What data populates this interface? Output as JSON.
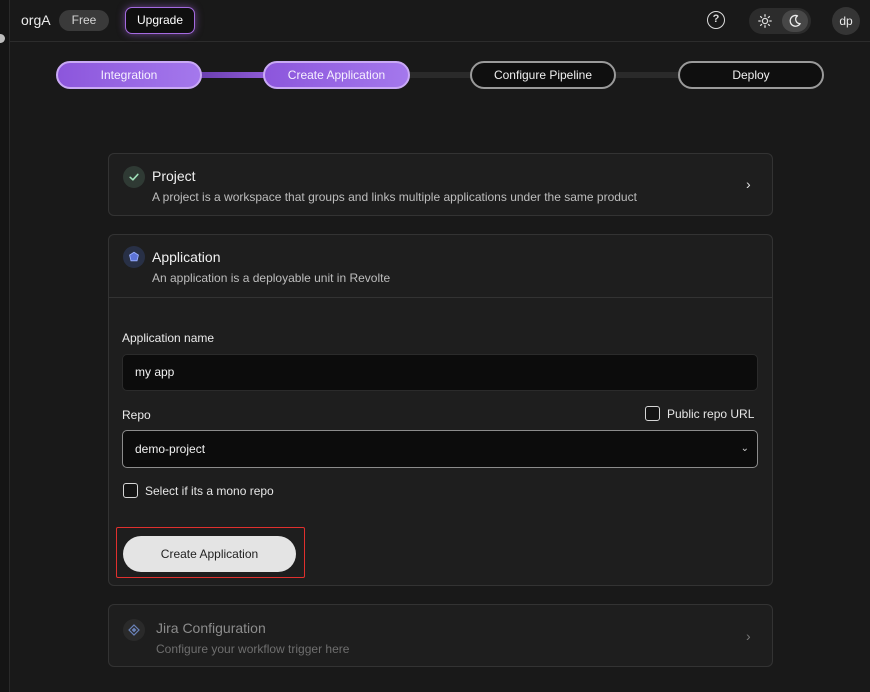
{
  "header": {
    "org_name": "orgA",
    "plan_badge": "Free",
    "upgrade_label": "Upgrade",
    "help_glyph": "?",
    "avatar_initials": "dp"
  },
  "stepper": {
    "steps": [
      {
        "label": "Integration",
        "state": "complete"
      },
      {
        "label": "Create Application",
        "state": "current"
      },
      {
        "label": "Configure Pipeline",
        "state": "todo"
      },
      {
        "label": "Deploy",
        "state": "todo"
      }
    ]
  },
  "project_card": {
    "title": "Project",
    "description": "A project is a workspace that groups and links multiple applications under the same product",
    "icon": "check-circle-icon"
  },
  "application_card": {
    "title": "Application",
    "description": "An application is a deployable unit in Revolte",
    "icon": "hexagon-icon",
    "form": {
      "name_label": "Application name",
      "name_value": "my app",
      "repo_label": "Repo",
      "public_repo_label": "Public repo URL",
      "public_repo_checked": false,
      "repo_value": "demo-project",
      "mono_repo_label": "Select if its a mono repo",
      "mono_repo_checked": false,
      "submit_label": "Create Application"
    }
  },
  "jira_card": {
    "title": "Jira Configuration",
    "description": "Configure your workflow trigger here",
    "icon": "jira-icon"
  },
  "colors": {
    "accent": "#9b6be6",
    "background": "#191919",
    "card": "#1e1e1e",
    "highlight": "#e0302e"
  }
}
